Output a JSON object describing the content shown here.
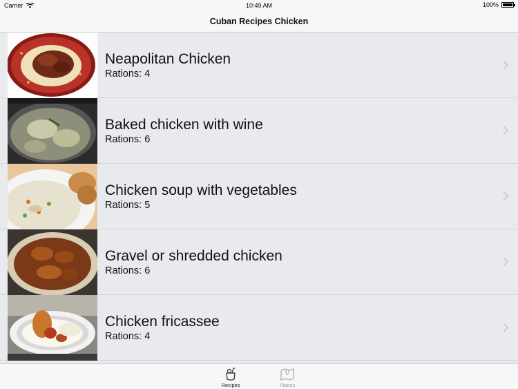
{
  "status_bar": {
    "carrier": "Carrier",
    "time": "10:49 AM",
    "battery": "100%",
    "battery_level": 1.0
  },
  "nav": {
    "title": "Cuban Recipes Chicken"
  },
  "recipes": [
    {
      "title": "Neapolitan Chicken",
      "rations": "Rations: 4",
      "image": "plate-of-stewed-chicken"
    },
    {
      "title": "Baked chicken with wine",
      "rations": "Rations: 6",
      "image": "pot-of-chicken-in-wine"
    },
    {
      "title": "Chicken soup with vegetables",
      "rations": "Rations: 5",
      "image": "bowl-of-chicken-soup"
    },
    {
      "title": "Gravel or shredded chicken",
      "rations": "Rations: 6",
      "image": "bowl-of-fried-chicken"
    },
    {
      "title": "Chicken fricassee",
      "rations": "Rations: 4",
      "image": "plate-of-chicken-fricassee"
    }
  ],
  "tabs": [
    {
      "label": "Recipes",
      "icon": "recipes-icon",
      "active": true
    },
    {
      "label": "Places",
      "icon": "map-icon",
      "active": false
    }
  ],
  "colors": {
    "list_background": "#e8eaed",
    "bar_background": "#f7f7f8",
    "chevron": "#c7c7cc"
  }
}
